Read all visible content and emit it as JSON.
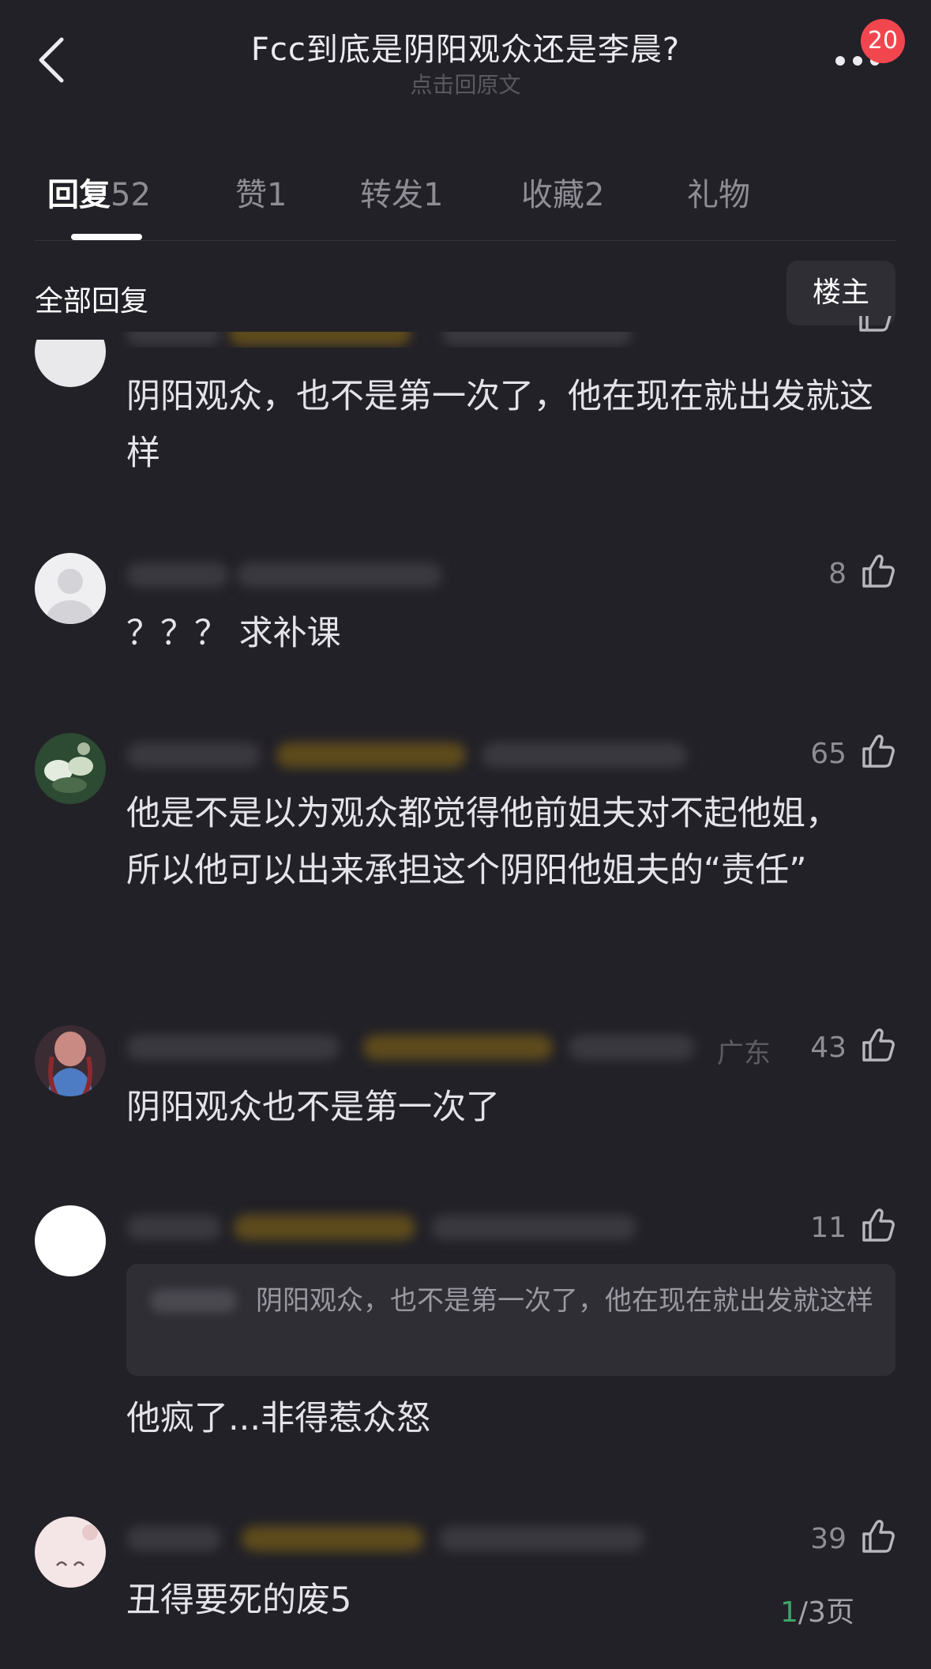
{
  "header": {
    "title": "Fcc到底是阴阳观众还是李晨?",
    "subtitle": "点击回原文",
    "notification_count": "20"
  },
  "tabs": [
    {
      "label": "回复",
      "count": "52"
    },
    {
      "label": "赞",
      "count": "1"
    },
    {
      "label": "转发",
      "count": "1"
    },
    {
      "label": "收藏",
      "count": "2"
    },
    {
      "label": "礼物",
      "count": ""
    }
  ],
  "filter": {
    "section_title": "全部回复",
    "op_button": "楼主"
  },
  "comments": [
    {
      "text": "阴阳观众，也不是第一次了，他在现在就出发就这样",
      "likes": ""
    },
    {
      "text": "？？？ 求补课",
      "likes": "8"
    },
    {
      "text": "他是不是以为观众都觉得他前姐夫对不起他姐，所以他可以出来承担这个阴阳他姐夫的“责任”",
      "likes": "65"
    },
    {
      "text": "阴阳观众也不是第一次了",
      "likes": "43",
      "location": "广东"
    },
    {
      "text": "他疯了...非得惹众怒",
      "likes": "11",
      "quoted_text": "阴阳观众，也不是第一次了，他在现在就出发就这样"
    },
    {
      "text": "丑得要死的废5",
      "likes": "39"
    }
  ],
  "pagination": {
    "current": "1",
    "total": "/3页"
  },
  "colors": {
    "background": "#222127",
    "badge": "#f2464e",
    "page_current": "#3fa56a"
  }
}
